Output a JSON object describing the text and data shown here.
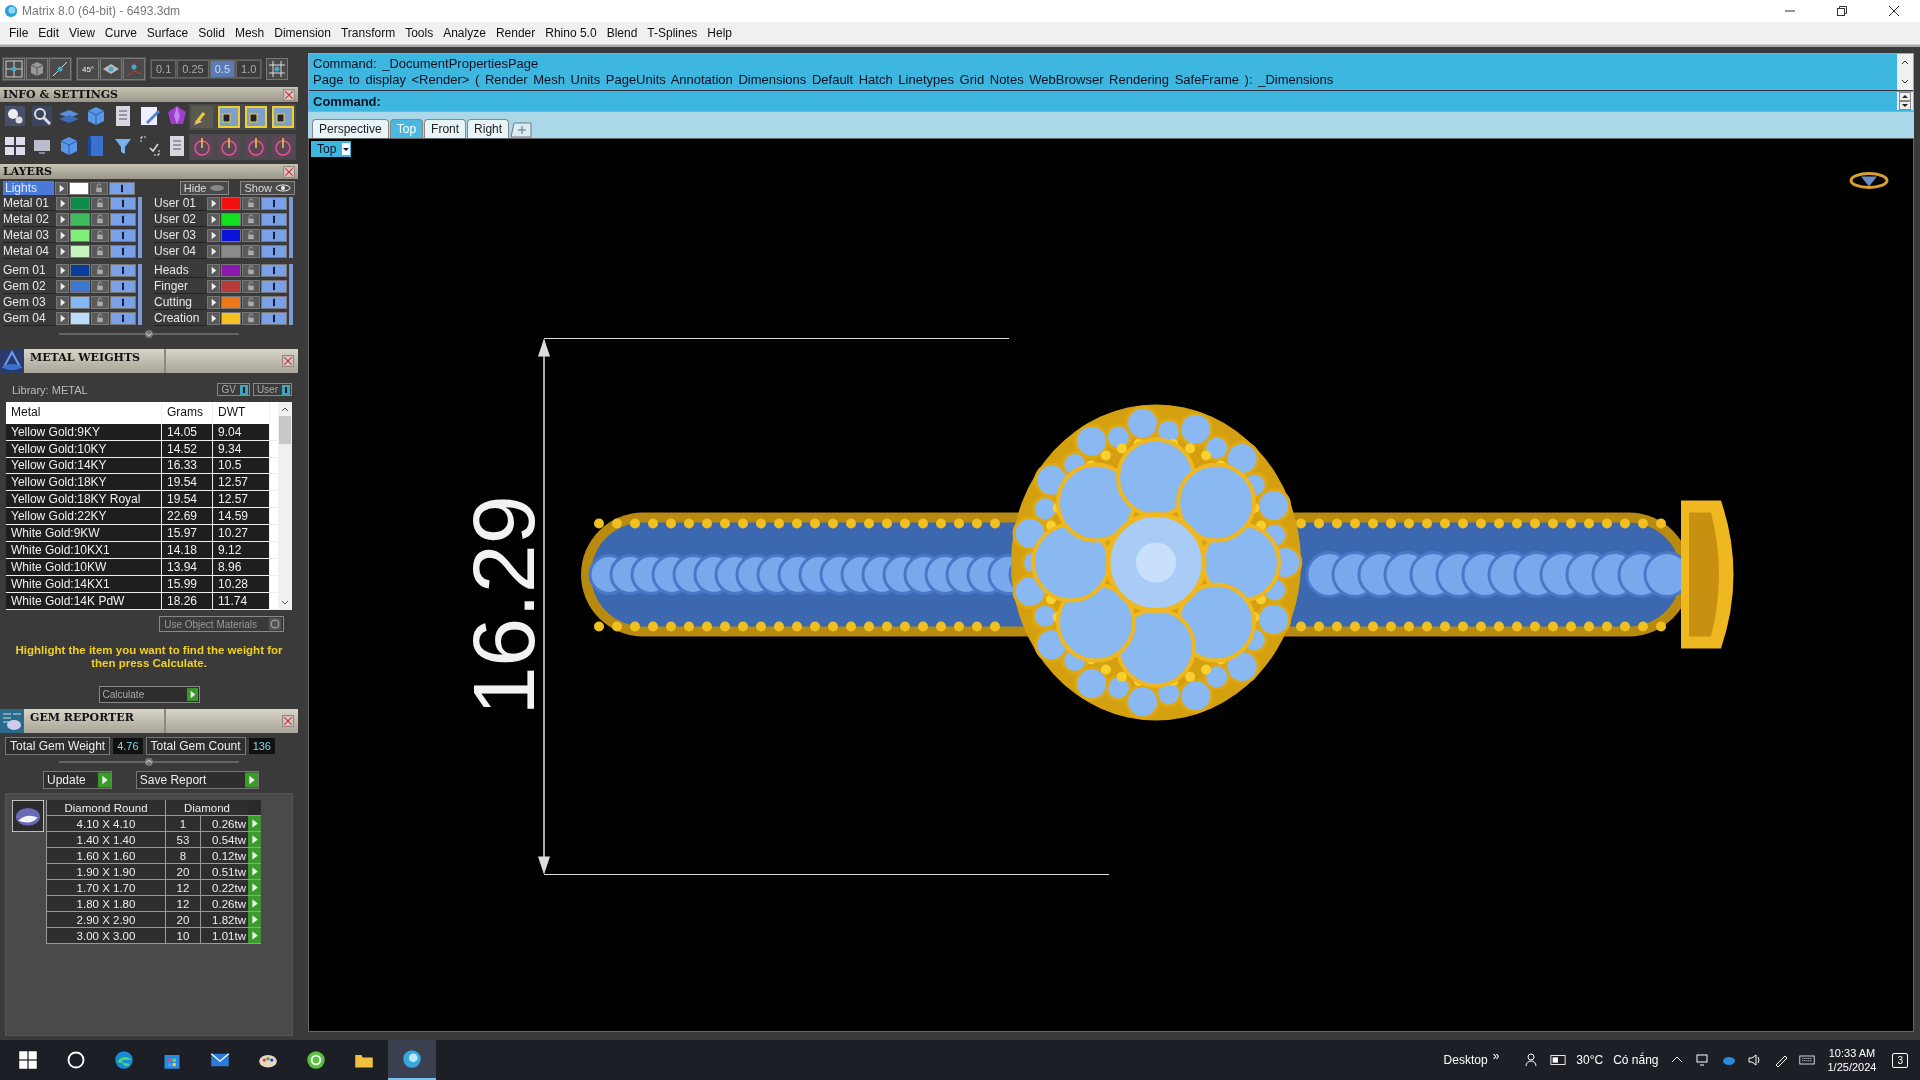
{
  "window": {
    "title": "Matrix 8.0 (64-bit) - 6493.3dm"
  },
  "menu": [
    "File",
    "Edit",
    "View",
    "Curve",
    "Surface",
    "Solid",
    "Mesh",
    "Dimension",
    "Transform",
    "Tools",
    "Analyze",
    "Render",
    "Rhino 5.0",
    "Blend",
    "T-Splines",
    "Help"
  ],
  "snap_toolbar": {
    "angle_label": "45°",
    "values": [
      {
        "label": "0.1",
        "selected": false
      },
      {
        "label": "0.25",
        "selected": false
      },
      {
        "label": "0.5",
        "selected": true
      },
      {
        "label": "1.0",
        "selected": false
      }
    ]
  },
  "info_panel": {
    "title": "INFO & SETTINGS"
  },
  "layers_panel": {
    "title": "LAYERS",
    "lights": {
      "label": "Lights",
      "color": "#ffffff"
    },
    "hide_label": "Hide",
    "show_label": "Show",
    "columns": [
      [
        [
          {
            "name": "Metal 01",
            "color": "#0e8a4a"
          },
          {
            "name": "Metal 02",
            "color": "#3cba5c"
          },
          {
            "name": "Metal 03",
            "color": "#7ef07a"
          },
          {
            "name": "Metal 04",
            "color": "#c4f5bc"
          }
        ],
        [
          {
            "name": "Gem 01",
            "color": "#0a3c9c"
          },
          {
            "name": "Gem 02",
            "color": "#3c78d0"
          },
          {
            "name": "Gem 03",
            "color": "#84b8f4"
          },
          {
            "name": "Gem 04",
            "color": "#bcdcfc"
          }
        ]
      ],
      [
        [
          {
            "name": "User 01",
            "color": "#f01010"
          },
          {
            "name": "User 02",
            "color": "#10e020"
          },
          {
            "name": "User 03",
            "color": "#0a14d8"
          },
          {
            "name": "User 04",
            "color": "#8a8a8a"
          }
        ],
        [
          {
            "name": "Heads",
            "color": "#8a18b0"
          },
          {
            "name": "Finger",
            "color": "#b83a3a"
          },
          {
            "name": "Cutting",
            "color": "#f07818"
          },
          {
            "name": "Creation",
            "color": "#f8c020"
          }
        ]
      ]
    ]
  },
  "metal_weights": {
    "title": "METAL WEIGHTS",
    "library": "Library: METAL",
    "toggles": [
      "GV",
      "User"
    ],
    "columns": [
      "Metal",
      "Grams",
      "DWT"
    ],
    "rows": [
      [
        "Yellow Gold:9KY",
        "14.05",
        "9.04"
      ],
      [
        "Yellow Gold:10KY",
        "14.52",
        "9.34"
      ],
      [
        "Yellow Gold:14KY",
        "16.33",
        "10.5"
      ],
      [
        "Yellow Gold:18KY",
        "19.54",
        "12.57"
      ],
      [
        "Yellow Gold:18KY Royal",
        "19.54",
        "12.57"
      ],
      [
        "Yellow Gold:22KY",
        "22.69",
        "14.59"
      ],
      [
        "White Gold:9KW",
        "15.97",
        "10.27"
      ],
      [
        "White Gold:10KX1",
        "14.18",
        "9.12"
      ],
      [
        "White Gold:10KW",
        "13.94",
        "8.96"
      ],
      [
        "White Gold:14KX1",
        "15.99",
        "10.28"
      ],
      [
        "White Gold:14K PdW",
        "18.26",
        "11.74"
      ]
    ],
    "use_object_materials": "Use Object Materials",
    "hint": "Highlight the item you want to find the weight for then press Calculate.",
    "calculate": "Calculate"
  },
  "gem_reporter": {
    "title": "GEM REPORTER",
    "total_weight_label": "Total Gem Weight",
    "total_weight": "4.76",
    "total_count_label": "Total Gem Count",
    "total_count": "136",
    "buttons": [
      "Update",
      "Save Report"
    ],
    "columns": [
      "Diamond Round",
      "Diamond"
    ],
    "rows": [
      [
        "4.10 X 4.10",
        "1",
        "0.26tw"
      ],
      [
        "1.40 X 1.40",
        "53",
        "0.54tw"
      ],
      [
        "1.60 X 1.60",
        "8",
        "0.12tw"
      ],
      [
        "1.90 X 1.90",
        "20",
        "0.51tw"
      ],
      [
        "1.70 X 1.70",
        "12",
        "0.22tw"
      ],
      [
        "1.80 X 1.80",
        "12",
        "0.26tw"
      ],
      [
        "2.90 X 2.90",
        "20",
        "1.82tw"
      ],
      [
        "3.00 X 3.00",
        "10",
        "1.01tw"
      ]
    ]
  },
  "command": {
    "history": [
      "Command: _DocumentPropertiesPage",
      "Page to display <Render> ( Render  Mesh  Units  PageUnits  Annotation  Dimensions  Default  Hatch  Linetypes  Grid  Notes  WebBrowser  Rendering  SafeFrame ): _Dimensions"
    ],
    "prompt": "Command:"
  },
  "viewport_tabs": [
    {
      "label": "Perspective",
      "selected": false
    },
    {
      "label": "Top",
      "selected": true
    },
    {
      "label": "Front",
      "selected": false
    },
    {
      "label": "Right",
      "selected": false
    }
  ],
  "viewport": {
    "label": "Top",
    "dimension": "16.29"
  },
  "taskbar": {
    "desktop": "Desktop",
    "chevron": "»",
    "temperature": "30°C",
    "weather": "Có nắng",
    "time": "10:33 AM",
    "date": "1/25/2024",
    "notifications": "3"
  }
}
